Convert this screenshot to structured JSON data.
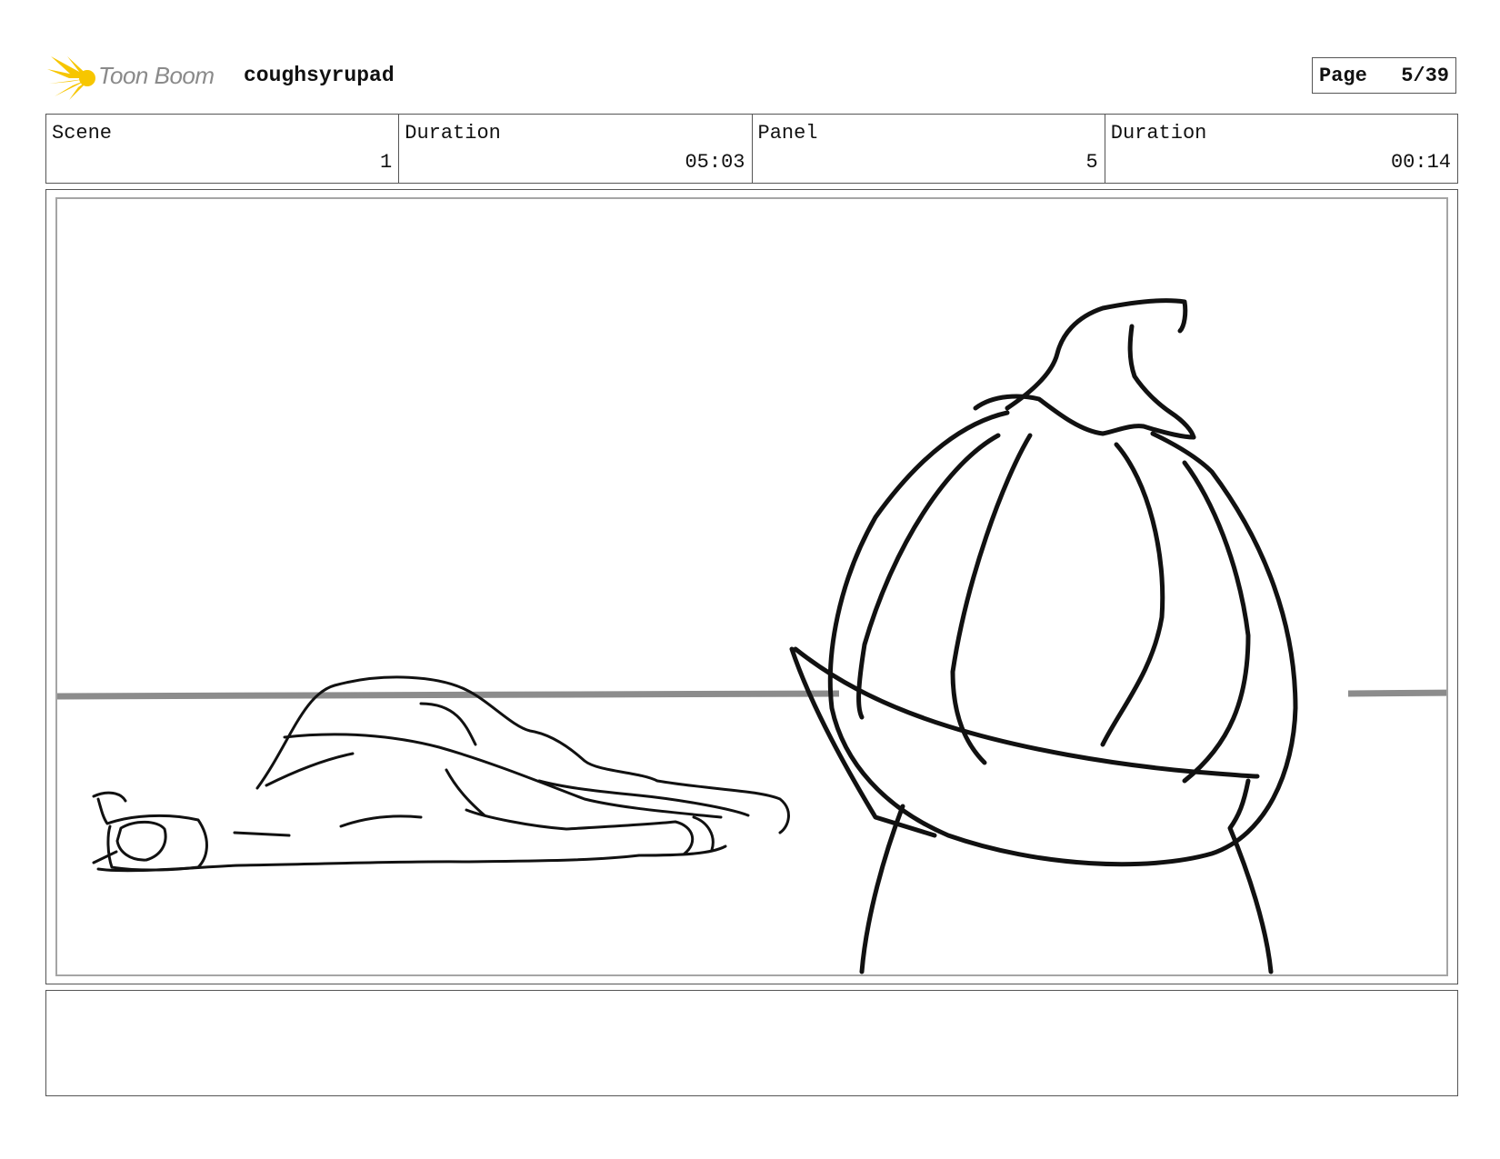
{
  "header": {
    "logo_text": "Toon Boom",
    "project_name": "coughsyrupad",
    "page_label": "Page",
    "page_number": "5/39"
  },
  "info": {
    "scene_label": "Scene",
    "scene_value": "1",
    "scene_duration_label": "Duration",
    "scene_duration_value": "05:03",
    "panel_label": "Panel",
    "panel_value": "5",
    "panel_duration_label": "Duration",
    "panel_duration_value": "00:14"
  },
  "notes": {
    "text": ""
  },
  "colors": {
    "logo_yellow": "#f7c600",
    "logo_text_gray": "#8a8a8a",
    "horizon_gray": "#8c8c8c",
    "frame_gray": "#a5a5a5"
  }
}
